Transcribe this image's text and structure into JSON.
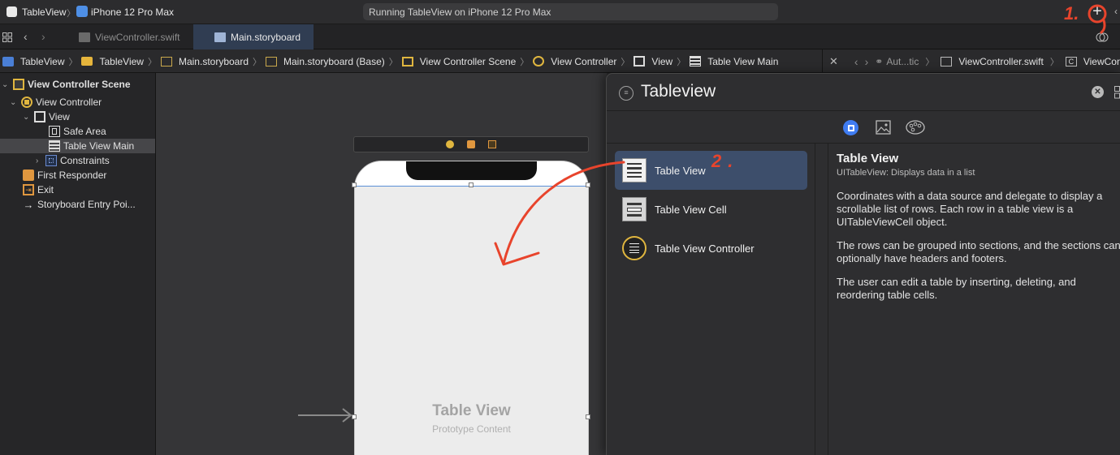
{
  "toolbar": {
    "project": "TableView",
    "device": "iPhone 12 Pro Max",
    "status": "Running TableView on iPhone 12 Pro Max",
    "annotation_1": "1.",
    "add_icon": "plus-icon"
  },
  "tabs": [
    {
      "label": "ViewController.swift"
    },
    {
      "label": "Main.storyboard"
    }
  ],
  "jumpbar": {
    "items": [
      "TableView",
      "TableView",
      "Main.storyboard",
      "Main.storyboard (Base)",
      "View Controller Scene",
      "View Controller",
      "View",
      "Table View Main"
    ],
    "right": [
      "Aut...tic",
      "ViewController.swift",
      "ViewContr"
    ]
  },
  "navigator": {
    "items": [
      {
        "label": "View Controller Scene",
        "icon": "scene-icon"
      },
      {
        "label": "View Controller",
        "icon": "view-controller-icon"
      },
      {
        "label": "View",
        "icon": "view-icon"
      },
      {
        "label": "Safe Area",
        "icon": "safe-area-icon"
      },
      {
        "label": "Table View Main",
        "icon": "table-view-icon"
      },
      {
        "label": "Constraints",
        "icon": "constraints-icon"
      },
      {
        "label": "First Responder",
        "icon": "first-responder-icon"
      },
      {
        "label": "Exit",
        "icon": "exit-icon"
      },
      {
        "label": "Storyboard Entry Poi...",
        "icon": "entry-arrow-icon"
      }
    ]
  },
  "canvas": {
    "table_title": "Table View",
    "table_subtitle": "Prototype Content"
  },
  "library": {
    "search_value": "Tableview",
    "items": [
      {
        "label": "Table View"
      },
      {
        "label": "Table View Cell"
      },
      {
        "label": "Table View Controller"
      }
    ],
    "annotation_2": "2.",
    "detail": {
      "title": "Table View",
      "subtitle": "UITableView: Displays data in a list",
      "p1": "Coordinates with a data source and delegate to display a scrollable list of rows. Each row in a table view is a UITableViewCell object.",
      "p2": "The rows can be grouped into sections, and the sections can optionally have headers and footers.",
      "p3": "The user can edit a table by inserting, deleting, and reordering table cells."
    }
  },
  "colors": {
    "accent": "#3f7cf2",
    "annotation": "#e8442c",
    "selection": "#3d4e6b"
  }
}
